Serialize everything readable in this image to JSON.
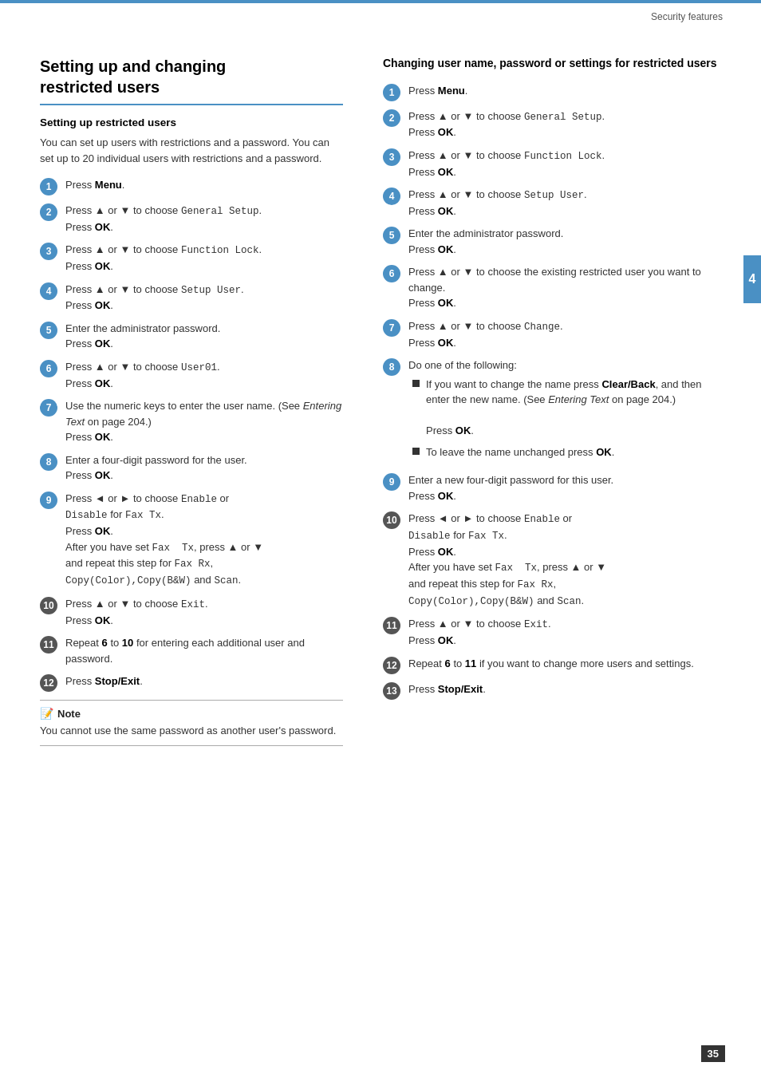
{
  "header": {
    "section": "Security features",
    "page": "35"
  },
  "side_tab": "4",
  "left": {
    "main_title": "Setting up and changing restricted users",
    "section1": {
      "title": "Setting up restricted users",
      "intro": "You can set up users with restrictions and a password. You can set up to 20 individual users with restrictions and a password.",
      "steps": [
        {
          "num": "1",
          "text": "Press ",
          "bold": "Menu",
          "after": "."
        },
        {
          "num": "2",
          "text": "Press ▲ or ▼ to choose ",
          "code": "General Setup",
          "after": ".\nPress ",
          "bold_after": "OK",
          "end": "."
        },
        {
          "num": "3",
          "text": "Press ▲ or ▼ to choose ",
          "code": "Function Lock",
          "after": ".\nPress ",
          "bold_after": "OK",
          "end": "."
        },
        {
          "num": "4",
          "text": "Press ▲ or ▼ to choose ",
          "code": "Setup User",
          "after": ".\nPress ",
          "bold_after": "OK",
          "end": "."
        },
        {
          "num": "5",
          "text": "Enter the administrator password.\nPress ",
          "bold": "OK",
          "after": "."
        },
        {
          "num": "6",
          "text": "Press ▲ or ▼ to choose ",
          "code": "User01",
          "after": ".\nPress ",
          "bold_after": "OK",
          "end": "."
        },
        {
          "num": "7",
          "text": "Use the numeric keys to enter the user name. (See ",
          "italic": "Entering Text",
          "after": " on page 204.)\nPress ",
          "bold_after": "OK",
          "end": "."
        },
        {
          "num": "8",
          "text": "Enter a four-digit password for the user.\nPress ",
          "bold": "OK",
          "after": "."
        },
        {
          "num": "9",
          "text": "Press ◄ or ► to choose ",
          "code": "Enable",
          "after": " or\n",
          "code2": "Disable",
          "after2": " for ",
          "code3": "Fax Tx",
          "after3": ".\nPress ",
          "bold_after": "OK",
          "end": ".\nAfter you have set ",
          "code4": "Fax  Tx",
          "after4": ", press ▲ or ▼\nand repeat this step for ",
          "code5": "Fax Rx",
          "after5": ",\n",
          "code6": "Copy(Color),Copy(B&W)",
          "after6": " and ",
          "code7": "Scan",
          "end2": "."
        },
        {
          "num": "10",
          "text": "Press ▲ or ▼ to choose ",
          "code": "Exit",
          "after": ".\nPress ",
          "bold_after": "OK",
          "end": "."
        },
        {
          "num": "11",
          "text": "Repeat ",
          "bold_ref": "6",
          "after": " to ",
          "bold_ref2": "10",
          "after2": " for entering each\nadditional user and password."
        },
        {
          "num": "12",
          "text": "Press ",
          "bold": "Stop/Exit",
          "after": "."
        }
      ],
      "note": {
        "title": "Note",
        "text": "You cannot use the same password as another user's password."
      }
    }
  },
  "right": {
    "section_title": "Changing user name, password or settings for restricted users",
    "steps": [
      {
        "num": "1",
        "text": "Press ",
        "bold": "Menu",
        "after": "."
      },
      {
        "num": "2",
        "text": "Press ▲ or ▼ to choose ",
        "code": "General Setup",
        "after": ".\nPress ",
        "bold_after": "OK",
        "end": "."
      },
      {
        "num": "3",
        "text": "Press ▲ or ▼ to choose ",
        "code": "Function Lock",
        "after": ".\nPress ",
        "bold_after": "OK",
        "end": "."
      },
      {
        "num": "4",
        "text": "Press ▲ or ▼ to choose ",
        "code": "Setup User",
        "after": ".\nPress ",
        "bold_after": "OK",
        "end": "."
      },
      {
        "num": "5",
        "text": "Enter the administrator password.\nPress ",
        "bold": "OK",
        "after": "."
      },
      {
        "num": "6",
        "text": "Press ▲ or ▼ to choose the existing\nrestricted user you want to change.\nPress ",
        "bold": "OK",
        "after": "."
      },
      {
        "num": "7",
        "text": "Press ▲ or ▼ to choose ",
        "code": "Change",
        "after": ".\nPress ",
        "bold_after": "OK",
        "end": "."
      },
      {
        "num": "8",
        "text": "Do one of the following:",
        "bullets": [
          {
            "text": "If you want to change the name press ",
            "bold": "Clear/Back",
            "after": ", and then enter the new name. (See ",
            "italic": "Entering Text",
            "after2": " on page 204.)\n\nPress ",
            "bold2": "OK",
            "end": "."
          },
          {
            "text": "To leave the name unchanged press ",
            "bold": "OK",
            "after": "."
          }
        ]
      },
      {
        "num": "9",
        "text": "Enter a new four-digit password for this\nuser.\nPress ",
        "bold": "OK",
        "after": "."
      },
      {
        "num": "10",
        "text": "Press ◄ or ► to choose ",
        "code": "Enable",
        "after": " or\n",
        "code2": "Disable",
        "after2": " for ",
        "code3": "Fax Tx",
        "after3": ".\nPress ",
        "bold_after": "OK",
        "end": ".\nAfter you have set ",
        "code4": "Fax  Tx",
        "after4": ", press ▲ or ▼\nand repeat this step for ",
        "code5": "Fax Rx",
        "after5": ",\n",
        "code6": "Copy(Color),Copy(B&W)",
        "after6": " and ",
        "code7": "Scan",
        "end2": "."
      },
      {
        "num": "11",
        "text": "Press ▲ or ▼ to choose ",
        "code": "Exit",
        "after": ".\nPress ",
        "bold_after": "OK",
        "end": "."
      },
      {
        "num": "12",
        "text": "Repeat ",
        "bold_ref": "6",
        "after": " to ",
        "bold_ref2": "11",
        "after2": " if you want to change\nmore users and settings."
      },
      {
        "num": "13",
        "text": "Press ",
        "bold": "Stop/Exit",
        "after": "."
      }
    ]
  }
}
